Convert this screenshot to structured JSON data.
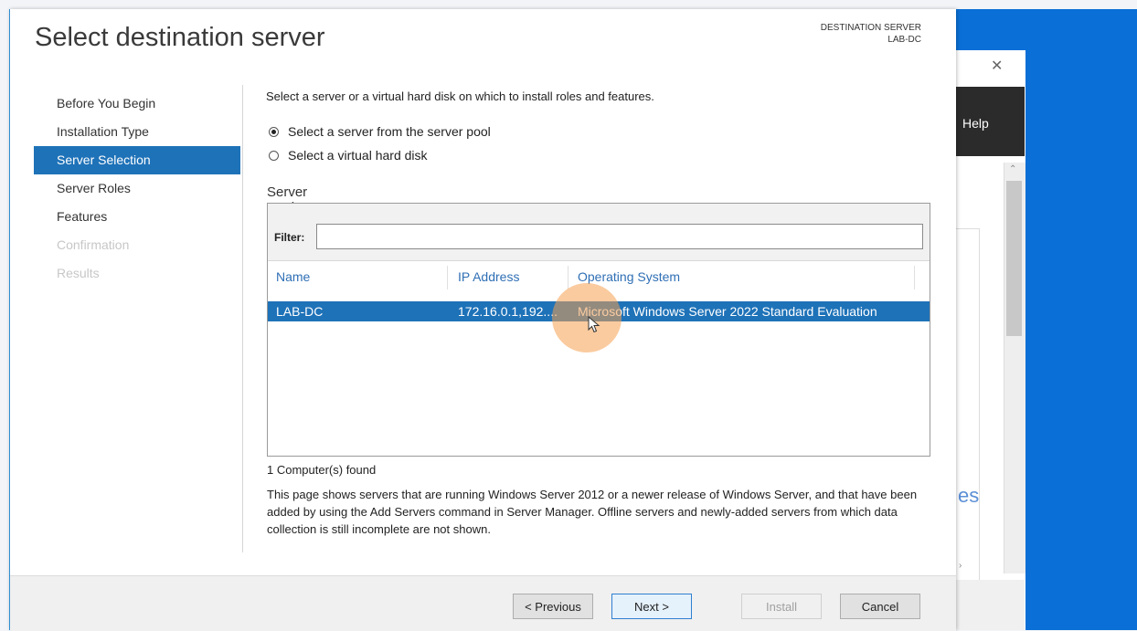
{
  "dialog": {
    "title": "Select destination server",
    "destination_label": "DESTINATION SERVER",
    "destination_value": "LAB-DC"
  },
  "nav": {
    "items": [
      {
        "label": "Before You Begin",
        "state": "normal"
      },
      {
        "label": "Installation Type",
        "state": "normal"
      },
      {
        "label": "Server Selection",
        "state": "active"
      },
      {
        "label": "Server Roles",
        "state": "normal"
      },
      {
        "label": "Features",
        "state": "normal"
      },
      {
        "label": "Confirmation",
        "state": "disabled"
      },
      {
        "label": "Results",
        "state": "disabled"
      }
    ]
  },
  "content": {
    "intro": "Select a server or a virtual hard disk on which to install roles and features.",
    "radio_pool": "Select a server from the server pool",
    "radio_vhd": "Select a virtual hard disk",
    "selected_radio": "pool",
    "pool_label": "Server Pool",
    "filter_label": "Filter:",
    "filter_value": "",
    "columns": {
      "name": "Name",
      "ip": "IP Address",
      "os": "Operating System"
    },
    "rows": [
      {
        "name": "LAB-DC",
        "ip": "172.16.0.1,192....",
        "os": "Microsoft Windows Server 2022 Standard Evaluation"
      }
    ],
    "found": "1 Computer(s) found",
    "description": "This page shows servers that are running Windows Server 2012 or a newer release of Windows Server, and that have been added by using the Add Servers command in Server Manager. Offline servers and newly-added servers from which data collection is still incomplete are not shown."
  },
  "buttons": {
    "previous": "< Previous",
    "next": "Next >",
    "install": "Install",
    "cancel": "Cancel"
  },
  "background_window": {
    "help": "Help",
    "partial_text": "es"
  },
  "colors": {
    "accent": "#1e72b8",
    "desktop": "#0a6fd6",
    "cursor_highlight": "#f5a050"
  }
}
